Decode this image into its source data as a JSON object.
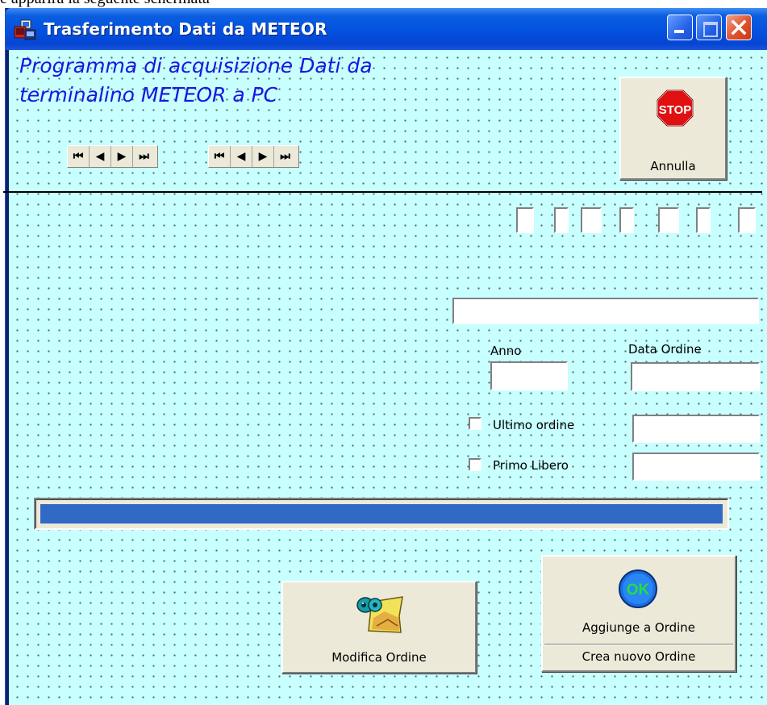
{
  "caption": "e apparirà la seguente schermata",
  "window": {
    "title": "Trasferimento Dati da METEOR"
  },
  "heading": {
    "line1": "Programma di acquisizione Dati da",
    "line2": "terminalino METEOR a PC"
  },
  "navigator": {
    "first": "⏮",
    "prev": "◀",
    "next": "▶",
    "last": "⏭"
  },
  "buttons": {
    "annulla_label": "Annulla",
    "stop_sign_text": "STOP",
    "modifica_label": "Modifica Ordine",
    "aggiunge_label": "Aggiunge a Ordine",
    "ok_text": "OK",
    "crea_label": "Crea nuovo Ordine"
  },
  "form": {
    "anno_label": "Anno",
    "data_ordine_label": "Data Ordine",
    "ultimo_ordine_label": "Ultimo ordine",
    "primo_libero_label": "Primo Libero",
    "ultimo_ordine_checked": false,
    "primo_libero_checked": false
  },
  "progress": {
    "value_percent": 100
  },
  "colors": {
    "client_bg": "#c8ffff",
    "heading": "#1717e0",
    "progress_fill": "#316ac5"
  }
}
